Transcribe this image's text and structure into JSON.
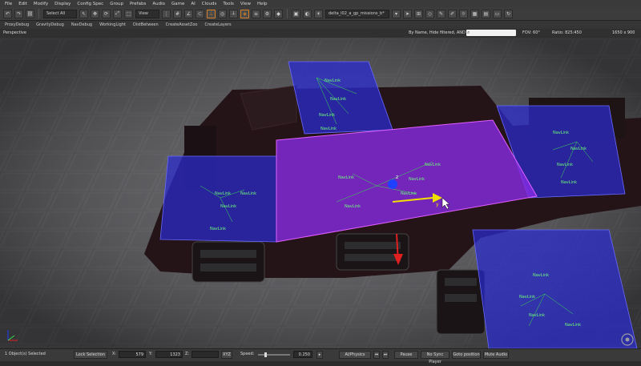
{
  "menu": [
    "File",
    "Edit",
    "Modify",
    "Display",
    "Config Spec",
    "Group",
    "Prefabs",
    "Audio",
    "Game",
    "AI",
    "Clouds",
    "Tools",
    "View",
    "Help"
  ],
  "toolbar": {
    "select_mode": "Select All",
    "view_mode": "View",
    "level_name": "delta_l02_a_gp_missions_b*"
  },
  "quickbar": [
    "ProxyDebug",
    "GravityDebug",
    "NavDebug",
    "WorkingLight",
    "DistBetween",
    "CreateAssetZoo",
    "CreateLayers"
  ],
  "viewport_header": {
    "view_label": "Perspective",
    "filter_label": "By Name, Hide filtered, AND",
    "search_value": "",
    "fov_label": "FOV:",
    "fov_value": "60°",
    "ratio_label": "Ratio:",
    "ratio_value": "825:450",
    "resolution": "1650 x 900"
  },
  "scene": {
    "nav_link_label": "NavLink",
    "gizmo_axis_y": "y",
    "gizmo_axis_z": "z",
    "colors": {
      "nav_volume": "#2b2bd0",
      "selected_volume": "#8a2be8",
      "nav_link": "#39e04f",
      "gizmo_y": "#f0e000",
      "gizmo_z": "#2040ff",
      "gizmo_x": "#e02020"
    }
  },
  "status": {
    "selected_text": "1 Object(s) Selected",
    "lock_selection": "Lock Selection",
    "x_label": "X:",
    "x_value": "579",
    "y_label": "Y:",
    "y_value": "1323",
    "z_label": "Z:",
    "z_value": "",
    "xyz_label": "XYZ",
    "speed_label": "Speed:",
    "speed_value": "0.250",
    "ai_physics": "AI/Physics",
    "pause": "Pause",
    "no_sync_player": "No Sync Player",
    "goto_position": "Goto position",
    "mute_audio": "Mute Audio"
  }
}
